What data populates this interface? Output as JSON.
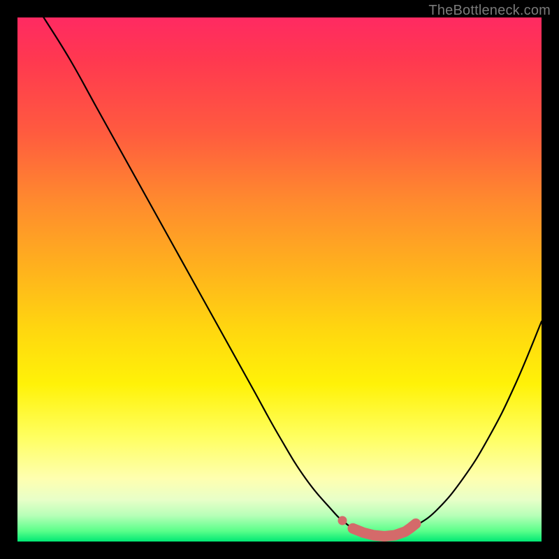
{
  "watermark": {
    "text": "TheBottleneck.com"
  },
  "colors": {
    "curve": "#000000",
    "marker": "#d46a6a",
    "marker_highlight": "#e07878"
  },
  "chart_data": {
    "type": "line",
    "title": "",
    "xlabel": "",
    "ylabel": "",
    "xlim": [
      0,
      100
    ],
    "ylim": [
      0,
      100
    ],
    "grid": false,
    "legend": false,
    "series": [
      {
        "name": "curve",
        "x": [
          5,
          10,
          15,
          20,
          25,
          30,
          35,
          40,
          45,
          50,
          55,
          60,
          62,
          64,
          66,
          68,
          70,
          72,
          74,
          76,
          80,
          85,
          90,
          95,
          100
        ],
        "values": [
          100,
          92,
          83,
          74,
          65,
          56,
          47,
          38,
          29,
          20,
          12,
          6,
          4,
          2.5,
          1.5,
          1,
          1,
          1.2,
          1.8,
          3,
          6,
          12,
          20,
          30,
          42
        ]
      }
    ],
    "markers": [
      {
        "x": 62,
        "y": 4.0
      },
      {
        "x": 64,
        "y": 2.5
      },
      {
        "x": 66,
        "y": 1.7
      },
      {
        "x": 68,
        "y": 1.2
      },
      {
        "x": 70,
        "y": 1.0
      },
      {
        "x": 72,
        "y": 1.2
      },
      {
        "x": 74,
        "y": 1.9
      },
      {
        "x": 75,
        "y": 2.6
      },
      {
        "x": 76,
        "y": 3.4
      }
    ]
  }
}
